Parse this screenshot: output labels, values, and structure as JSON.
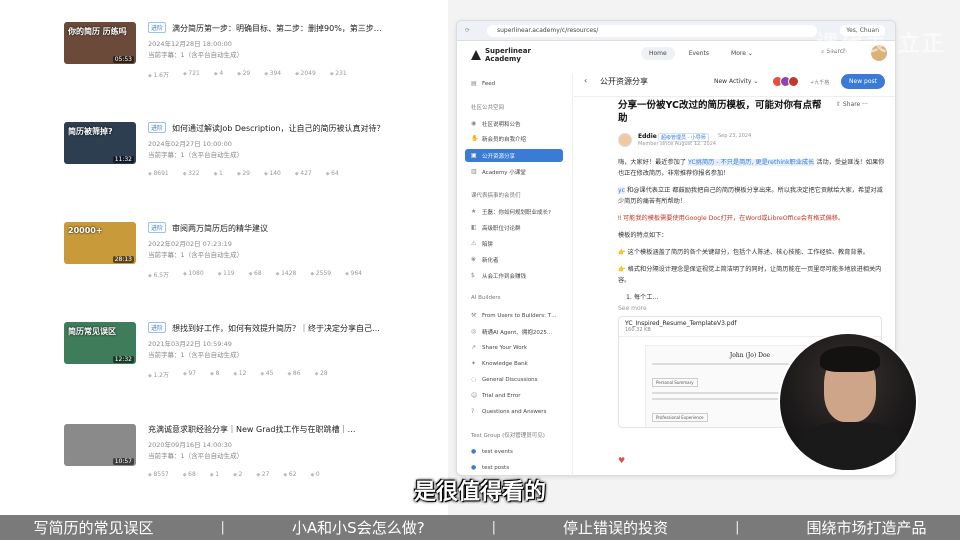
{
  "videos": [
    {
      "tag": "进阶",
      "title": "满分简历第一步：明确目标、第二步：删掉90%，第三步…",
      "date": "2024年12月28日 18:00:00",
      "subs": "当前字幕：1（含平台自动生成）",
      "stats": [
        "1.6万",
        "721",
        "4",
        "29",
        "394",
        "2049",
        "231"
      ],
      "cap": "你的简历 历练吗",
      "dur": "05:53",
      "color": "#6b4a3a"
    },
    {
      "tag": "进阶",
      "title": "如何通过解读Job Description，让自己的简历被认真对待？",
      "date": "2024年02月27日 10:00:00",
      "subs": "当前字幕：1（含平台自动生成）",
      "stats": [
        "8691",
        "322",
        "1",
        "29",
        "140",
        "427",
        "64"
      ],
      "cap": "简历被筛掉?",
      "dur": "11:32",
      "color": "#2c3e50"
    },
    {
      "tag": "进阶",
      "title": "审阅两万简历后的精华建议",
      "date": "2022年02月02日 07:23:19",
      "subs": "当前字幕：1（含平台自动生成）",
      "stats": [
        "6.5万",
        "1080",
        "119",
        "68",
        "1428",
        "2559",
        "964"
      ],
      "cap": "20000+",
      "dur": "28:13",
      "color": "#c89a3a"
    },
    {
      "tag": "进阶",
      "title": "想找到好工作，如何有效提升简历？｜终于决定分享自己…",
      "date": "2021年03月22日 10:59:49",
      "subs": "当前字幕：1（含平台自动生成）",
      "stats": [
        "1.2万",
        "97",
        "8",
        "12",
        "45",
        "86",
        "28"
      ],
      "cap": "简历常见误区",
      "dur": "12:32",
      "color": "#3e7c5a"
    },
    {
      "tag": "",
      "title": "充满诚意求职经验分享｜New Grad找工作与在职跳槽｜…",
      "date": "2020年09月16日 14:00:30",
      "subs": "当前字幕：1（含平台自动生成）",
      "stats": [
        "8557",
        "68",
        "1",
        "2",
        "27",
        "62",
        "0"
      ],
      "cap": "",
      "dur": "10:57",
      "color": "#8a8a8a"
    }
  ],
  "browser": {
    "url": "superlinear.academy/c/resources/",
    "account": "Yes, Chuan",
    "logo": "Superlinear Academy",
    "nav": [
      "Home",
      "Events",
      "More ⌄"
    ],
    "search": "⌕ Search",
    "sidebar": {
      "feed": "Feed",
      "section1": "社区公共空间",
      "items1": [
        "社区说明和公告",
        "新会员的自我介绍",
        "公开资源分享",
        "Academy 小课堂"
      ],
      "section2": "课代表搞事的会员们",
      "items2": [
        "王磊：你如何规划职业成长?",
        "高级职位讨论群",
        "陷阱",
        "新化者",
        "从会工作到会赚钱"
      ],
      "section3": "AI Builders",
      "items3": [
        "From Users to Builders: T…",
        "精通AI Agent、拥抱2025…",
        "Share Your Work",
        "Knowledge Bank",
        "General Discussions",
        "Trial and Error",
        "Questions and Answers"
      ],
      "section4": "Test Group (仅对管理员可见)",
      "items4": [
        "test events",
        "test posts"
      ]
    },
    "main": {
      "page_title": "公开资源分享",
      "sort": "New Activity ⌄",
      "member_count": "+九千格",
      "new_post": "New post"
    },
    "post": {
      "title": "分享一份被YC改过的简历模板，可能对你有点帮助",
      "share": "⇧ Share ···",
      "author": "Eddie",
      "badge": "超级管理员 · 小导师",
      "date": "Sep 23, 2024",
      "member_since": "Member since August 12, 2024",
      "p1_a": "嗨，大家好！最近参加了",
      "p1_link": "YC挑简历 - 不只是简历, 更是rethink职业成长",
      "p1_b": "活动，受益匪浅！如果你也正在修改简历，非常推荐你报名参加！",
      "p2_tag": "yc",
      "p2": "和@课代表立正 都鼓励我把自己的简历模板分享出来。所以我决定把它贡献给大家，希望对减少简历的痛苦有所帮助！",
      "p3": "‼ 可能我的模板需要使用Google Doc打开，在Word或LibreOffice会有格式偏移。",
      "p4": "模板的特点如下：",
      "p5": "👉 这个模板涵盖了简历的各个关键部分，包括个人陈述、核心技能、工作经验、教育背景。",
      "p6": "👉 格式和分隔设计理念是保证视觉上简洁明了的同时，让简历能在一页里尽可能多地放进相关内容。",
      "p7": "1. 每个工…",
      "see_more": "See more",
      "file_name": "YC_Inspired_Resume_TemplateV3.pdf",
      "file_size": "160.32 KB",
      "resume_name": "John (Jo) Doe",
      "resume_sec1": "Personal Summary",
      "resume_sec2": "Professional Experience",
      "reaction": "♥"
    }
  },
  "watermark": "课代表 立正",
  "subtitle": "是很值得看的",
  "bottom_bar": [
    "写简历的常见误区",
    "小A和小S会怎么做?",
    "停止错误的投资",
    "围绕市场打造产品"
  ],
  "separator": "|"
}
